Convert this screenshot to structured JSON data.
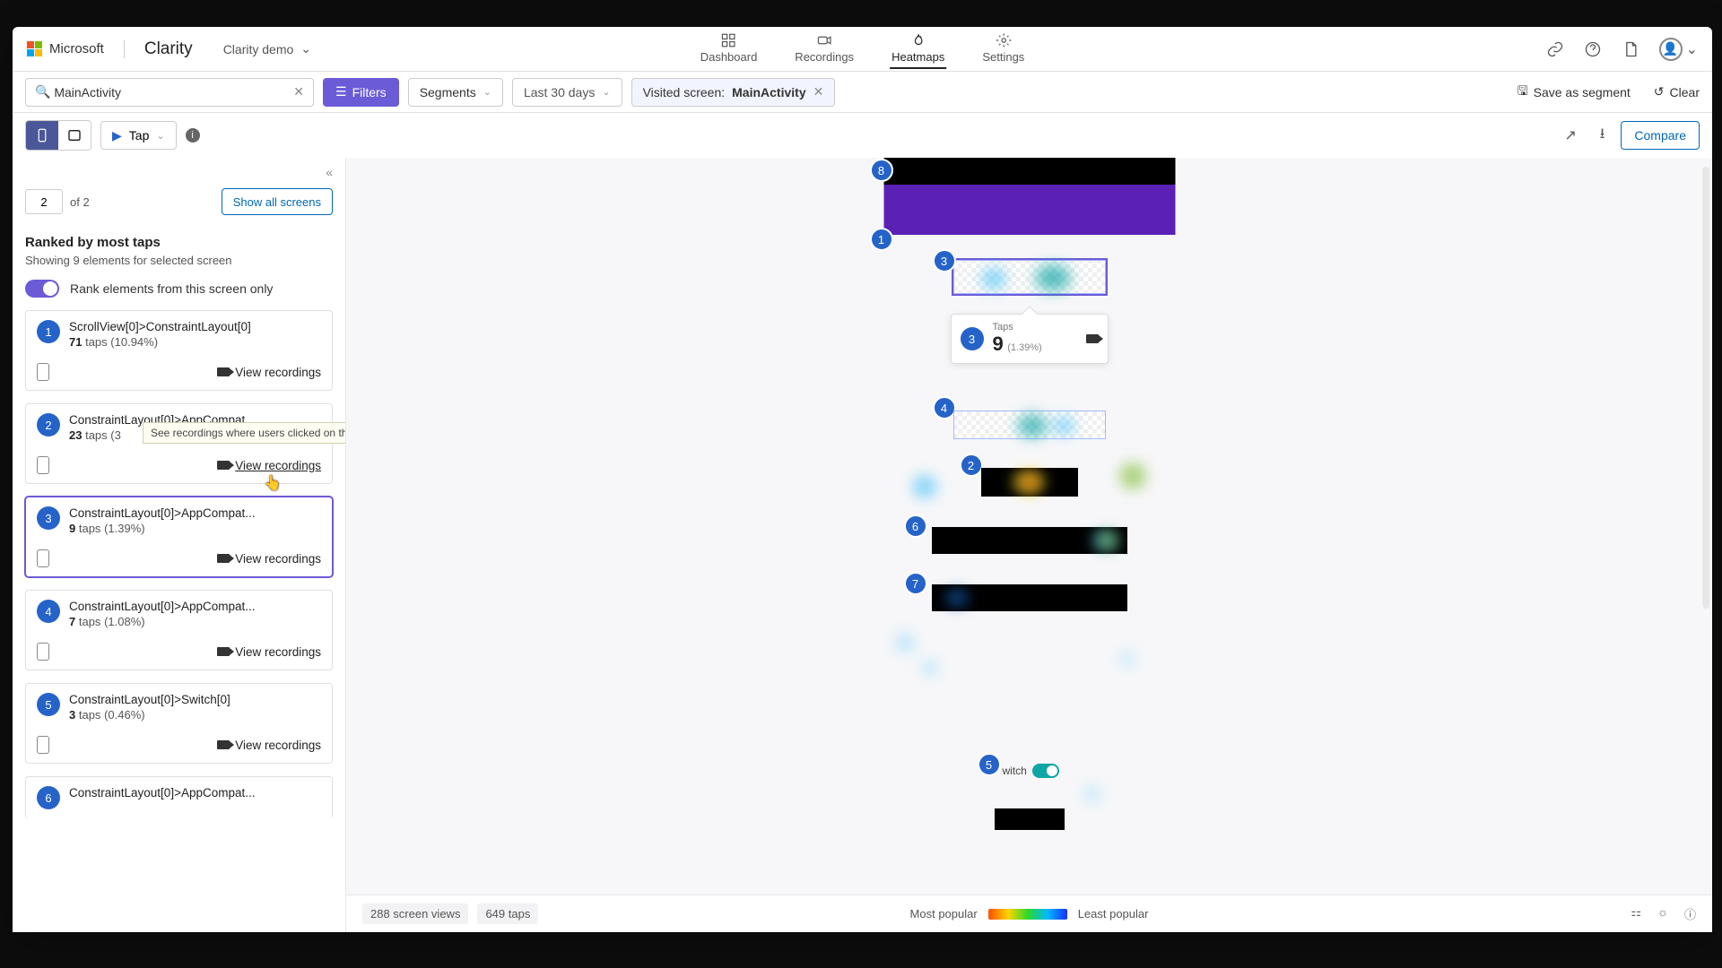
{
  "header": {
    "ms": "Microsoft",
    "brand": "Clarity",
    "project": "Clarity demo",
    "nav": {
      "dashboard": "Dashboard",
      "recordings": "Recordings",
      "heatmaps": "Heatmaps",
      "settings": "Settings"
    }
  },
  "filters": {
    "search": "MainActivity",
    "filters_btn": "Filters",
    "segments": "Segments",
    "date": "Last 30 days",
    "visited_label": "Visited screen:",
    "visited_value": "MainActivity",
    "save_seg": "Save as segment",
    "clear": "Clear"
  },
  "toolbar": {
    "tap": "Tap",
    "compare": "Compare"
  },
  "side": {
    "page_value": "2",
    "page_of": "of 2",
    "show_all": "Show all screens",
    "title": "Ranked by most taps",
    "subtitle": "Showing 9 elements for selected screen",
    "toggle_label": "Rank elements from this screen only",
    "view_rec": "View recordings",
    "tooltip": "See recordings where users clicked on this element",
    "cards": [
      {
        "rank": "1",
        "title": "ScrollView[0]>ConstraintLayout[0]",
        "count": "71",
        "unit": "taps",
        "pct": "(10.94%)"
      },
      {
        "rank": "2",
        "title": "ConstraintLayout[0]>AppCompat...",
        "count": "23",
        "unit": "taps",
        "pct": "(3"
      },
      {
        "rank": "3",
        "title": "ConstraintLayout[0]>AppCompat...",
        "count": "9",
        "unit": "taps",
        "pct": "(1.39%)"
      },
      {
        "rank": "4",
        "title": "ConstraintLayout[0]>AppCompat...",
        "count": "7",
        "unit": "taps",
        "pct": "(1.08%)"
      },
      {
        "rank": "5",
        "title": "ConstraintLayout[0]>Switch[0]",
        "count": "3",
        "unit": "taps",
        "pct": "(0.46%)"
      },
      {
        "rank": "6",
        "title": "ConstraintLayout[0]>AppCompat...",
        "count": "",
        "unit": "",
        "pct": ""
      }
    ]
  },
  "popup": {
    "rank": "3",
    "label": "Taps",
    "count": "9",
    "pct": "(1.39%)"
  },
  "heatmap": {
    "switch_label": "witch"
  },
  "footer": {
    "views": "288 screen views",
    "taps": "649 taps",
    "most": "Most popular",
    "least": "Least popular"
  }
}
